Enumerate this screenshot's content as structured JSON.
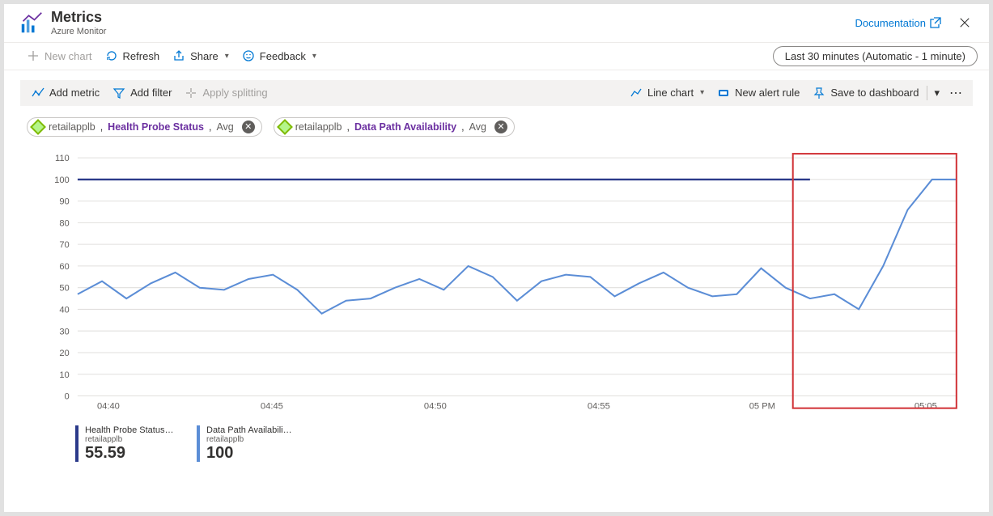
{
  "header": {
    "title": "Metrics",
    "subtitle": "Azure Monitor",
    "documentation_label": "Documentation"
  },
  "toolbar": {
    "new_chart": "New chart",
    "refresh": "Refresh",
    "share": "Share",
    "feedback": "Feedback",
    "timerange": "Last 30 minutes (Automatic - 1 minute)"
  },
  "chart_toolbar": {
    "add_metric": "Add metric",
    "add_filter": "Add filter",
    "apply_splitting": "Apply splitting",
    "line_chart": "Line chart",
    "new_alert_rule": "New alert rule",
    "save_dashboard": "Save to dashboard"
  },
  "pills": [
    {
      "resource": "retailapplb",
      "metric": "Health Probe Status",
      "agg": "Avg"
    },
    {
      "resource": "retailapplb",
      "metric": "Data Path Availability",
      "agg": "Avg"
    }
  ],
  "legend": [
    {
      "name": "Health Probe Status …",
      "resource": "retailapplb",
      "value": "55.59"
    },
    {
      "name": "Data Path Availabili…",
      "resource": "retailapplb",
      "value": "100"
    }
  ],
  "chart_data": {
    "type": "line",
    "x_labels": [
      "04:40",
      "04:45",
      "04:50",
      "04:55",
      "05 PM",
      "05:05"
    ],
    "y_ticks": [
      0,
      10,
      20,
      30,
      40,
      50,
      60,
      70,
      80,
      90,
      100,
      110
    ],
    "ylim": [
      0,
      110
    ],
    "x": [
      0,
      1,
      2,
      3,
      4,
      5,
      6,
      7,
      8,
      9,
      10,
      11,
      12,
      13,
      14,
      15,
      16,
      17,
      18,
      19,
      20,
      21,
      22,
      23,
      24,
      25,
      26,
      27,
      28,
      29,
      30
    ],
    "series": [
      {
        "name": "Data Path Availability",
        "color": "#2b3a8a",
        "values": [
          100,
          100,
          100,
          100,
          100,
          100,
          100,
          100,
          100,
          100,
          100,
          100,
          100,
          100,
          100,
          100,
          100,
          100,
          100,
          100,
          100,
          100,
          100,
          100,
          100,
          100,
          100,
          100,
          100,
          100,
          100
        ]
      },
      {
        "name": "Health Probe Status",
        "color": "#5b8dd6",
        "values": [
          47,
          53,
          45,
          52,
          57,
          50,
          49,
          54,
          56,
          49,
          38,
          44,
          45,
          50,
          54,
          49,
          60,
          55,
          44,
          53,
          56,
          55,
          46,
          52,
          57,
          50,
          46,
          47,
          59,
          50,
          45,
          47,
          40,
          60,
          86,
          100,
          100
        ]
      }
    ],
    "highlight_x_range": [
      29.3,
      34
    ]
  }
}
